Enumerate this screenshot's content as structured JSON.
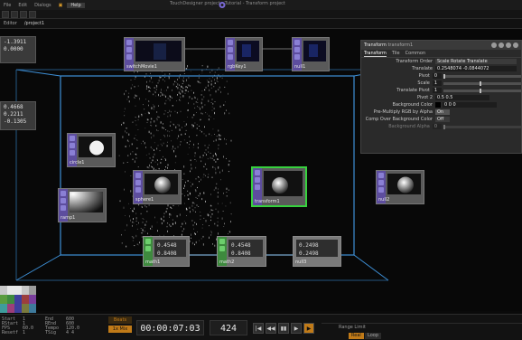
{
  "menubar": {
    "items": [
      "File",
      "Edit",
      "Dialogs",
      "",
      "Help"
    ],
    "title": "TouchDesigner project - Tutorial - Transform project"
  },
  "pathbar": {
    "tab": "Editor",
    "path": "/project1"
  },
  "nodes": [
    {
      "id": "top1",
      "label": "switchMovie1"
    },
    {
      "id": "top2",
      "label": "rgbKey1"
    },
    {
      "id": "top3",
      "label": "null1"
    },
    {
      "id": "circle",
      "label": "circle1"
    },
    {
      "id": "ramp",
      "label": "ramp1"
    },
    {
      "id": "sphere1",
      "label": "sphere1"
    },
    {
      "id": "transform",
      "label": "transform1"
    },
    {
      "id": "sphere2",
      "label": "null2"
    },
    {
      "id": "chop1",
      "label": "math1",
      "values": [
        "0.4548",
        "0.8408"
      ]
    },
    {
      "id": "chop2",
      "label": "math2",
      "values": [
        "0.4548",
        "0.8408"
      ]
    },
    {
      "id": "chop3",
      "label": "null3",
      "values": [
        "0.2498",
        "0.2498"
      ]
    }
  ],
  "side_values": {
    "top": [
      "-1.3911",
      "0.0000"
    ],
    "mid": [
      "0.4668",
      "0.2211",
      "-0.1305"
    ]
  },
  "params": {
    "title": "Transform",
    "subtitle": "transform1",
    "tabs": [
      "Transform",
      "Tile",
      "Common"
    ],
    "rows": [
      {
        "label": "Transform Order",
        "value": "Scale Rotate Translate"
      },
      {
        "label": "Translate",
        "value": "0.2548074   -0.0844072"
      },
      {
        "label": "Pivot",
        "value": "0"
      },
      {
        "label": "Scale",
        "value": "1"
      },
      {
        "label": "Translate Pivot",
        "value": "1"
      },
      {
        "label": "Pivot 2",
        "value": "0.5   0.5"
      },
      {
        "label": "Background Color",
        "value": "0   0   0"
      },
      {
        "label": "Pre-Multiply RGB by Alpha",
        "value": "On"
      },
      {
        "label": "Comp Over Background Color",
        "value": "Off"
      },
      {
        "label": "Background Alpha",
        "value": "0"
      }
    ]
  },
  "colors": {
    "accent": "#c07a18",
    "selection": "#37d13e",
    "top_strip": "#5d4d9e",
    "chop_strip": "#3e8a3e",
    "wire": "#3d8fd6"
  },
  "swatches": [
    "#c8c8c8",
    "#e8e8e8",
    "#e8e8e8",
    "#c8c8c8",
    "#9c9c9c",
    "#5a9c3e",
    "#3e8a3e",
    "#3e3e9c",
    "#9c3e3e",
    "#7a3e9c",
    "#3e9c9c",
    "#9c3e7a",
    "#3e3e9c",
    "#7a7a3e",
    "#3e7a9c"
  ],
  "status": {
    "rows": [
      [
        "Start",
        "1",
        "End",
        "600"
      ],
      [
        "RStart",
        "1",
        "REnd",
        "600"
      ],
      [
        "FPS",
        "60.0",
        "Tempo",
        "120.0"
      ],
      [
        "Resetf",
        "1",
        "TSig",
        "4 4"
      ]
    ],
    "rate": "1x Mix",
    "rate_top": "Beats",
    "timecode": "00:00:07:03",
    "frame": "424",
    "buttons": [
      "|◀",
      "◀◀",
      "▮▮",
      "▶",
      "▶"
    ],
    "stats": "Range Limit",
    "realtime": "Real",
    "realtime_alt": "Loop"
  }
}
